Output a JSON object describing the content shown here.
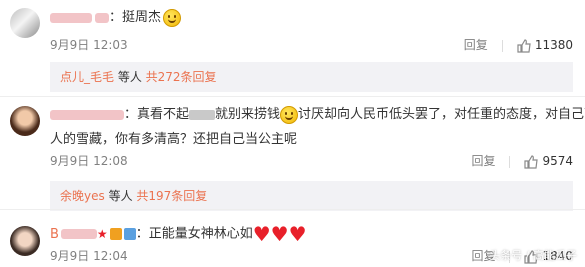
{
  "comments": [
    {
      "text": "：挺周杰",
      "time": "9月9日 12:03",
      "reply_label": "回复",
      "likes": "11380",
      "replies": {
        "users": "点儿_毛毛",
        "others": " 等人 ",
        "count_link": "共272条回复"
      }
    },
    {
      "text_part1": "：真看不起",
      "text_part2": "就别来捞钱",
      "text_part3": "讨厌却向人民币低头罢了，对任重的态度，对自己艺",
      "text_line2": "人的雪藏，你有多清高？还把自己当公主呢",
      "time": "9月9日 12:08",
      "reply_label": "回复",
      "likes": "9574",
      "replies": {
        "users": "余晚yes",
        "others": " 等人 ",
        "count_link": "共197条回复"
      }
    },
    {
      "user_prefix": "B",
      "text": "：正能量女神林心如",
      "time": "9月9日 12:04",
      "reply_label": "回复",
      "likes": "1840"
    }
  ],
  "watermark": "头条号 / 高能瓜子",
  "icons": {
    "like": "thumbs-up-icon",
    "emoji_smile": "smile-emoji-icon",
    "heart": "heart-emoji-icon"
  }
}
